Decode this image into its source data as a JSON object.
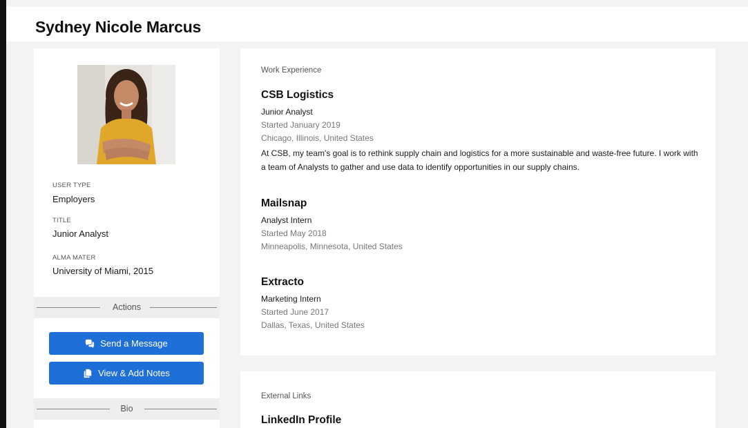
{
  "profile": {
    "name": "Sydney Nicole Marcus",
    "fields": [
      {
        "label": "USER TYPE",
        "value": "Employers"
      },
      {
        "label": "TITLE",
        "value": "Junior Analyst"
      },
      {
        "label": "ALMA MATER",
        "value": "University of Miami, 2015"
      }
    ],
    "actions_label": "Actions",
    "send_message_label": "Send a Message",
    "notes_label": "View & Add Notes",
    "bio_label": "Bio"
  },
  "work": {
    "heading": "Work Experience",
    "jobs": [
      {
        "company": "CSB Logistics",
        "role": "Junior Analyst",
        "started": "Started January 2019",
        "location": "Chicago, Illinois, United States",
        "description": "At CSB, my team's goal is to rethink supply chain and logistics for a more sustainable and waste-free future. I work with a team of Analysts to gather and use data to identify opportunities in our supply chains."
      },
      {
        "company": "Mailsnap",
        "role": "Analyst Intern",
        "started": "Started May 2018",
        "location": "Minneapolis, Minnesota, United States"
      },
      {
        "company": "Extracto",
        "role": "Marketing Intern",
        "started": "Started June 2017",
        "location": "Dallas, Texas, United States"
      }
    ]
  },
  "links": {
    "heading": "External Links",
    "first_title": "LinkedIn Profile"
  },
  "colors": {
    "primary_button": "#1f6fd8",
    "background": "#f3f3f3"
  },
  "icons": {
    "send_message": "chat-bubbles-icon",
    "notes": "copy-notes-icon"
  }
}
